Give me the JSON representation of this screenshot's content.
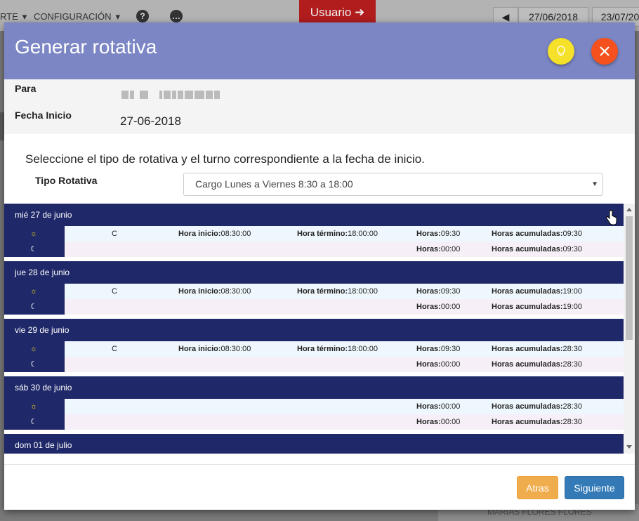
{
  "background": {
    "menu_report": "RTE",
    "menu_config": "CONFIGURACIÓN",
    "user_button": "Usuario",
    "date_from": "27/06/2018",
    "date_to": "23/07/20",
    "footer_text": "MARIAS FLORES FLORES"
  },
  "modal": {
    "title": "Generar rotativa",
    "para_label": "Para",
    "fecha_inicio_label": "Fecha Inicio",
    "fecha_inicio_value": "27-06-2018",
    "instruction": "Seleccione el tipo de rotativa y el turno correspondiente a la fecha de inicio.",
    "tipo_label": "Tipo Rotativa",
    "tipo_selected": "Cargo Lunes a Viernes 8:30 a 18:00",
    "back_button": "Atras",
    "next_button": "Siguiente"
  },
  "labels": {
    "hora_inicio": "Hora inicio:",
    "hora_termino": "Hora término:",
    "horas": "Horas:",
    "horas_acumuladas": "Horas acumuladas:"
  },
  "days": [
    {
      "date": "mié 27 de junio",
      "day_shift": {
        "code": "C",
        "inicio": "08:30:00",
        "termino": "18:00:00",
        "horas": "09:30",
        "acumuladas": "09:30"
      },
      "night_shift": {
        "horas": "00:00",
        "acumuladas": "09:30"
      }
    },
    {
      "date": "jue 28 de junio",
      "day_shift": {
        "code": "C",
        "inicio": "08:30:00",
        "termino": "18:00:00",
        "horas": "09:30",
        "acumuladas": "19:00"
      },
      "night_shift": {
        "horas": "00:00",
        "acumuladas": "19:00"
      }
    },
    {
      "date": "vie 29 de junio",
      "day_shift": {
        "code": "C",
        "inicio": "08:30:00",
        "termino": "18:00:00",
        "horas": "09:30",
        "acumuladas": "28:30"
      },
      "night_shift": {
        "horas": "00:00",
        "acumuladas": "28:30"
      }
    },
    {
      "date": "sáb 30 de junio",
      "day_shift": {
        "code": "",
        "inicio": "",
        "termino": "",
        "horas": "00:00",
        "acumuladas": "28:30"
      },
      "night_shift": {
        "horas": "00:00",
        "acumuladas": "28:30"
      }
    },
    {
      "date": "dom 01 de julio"
    }
  ],
  "colors": {
    "header_bg": "#7c86c4",
    "day_header_bg": "#1f2868",
    "hint_button": "#f5e12a",
    "close_button": "#f4511e",
    "back_button": "#f0ad4e",
    "next_button": "#337ab7"
  },
  "icons": {
    "hint": "lightbulb-icon",
    "close": "close-icon",
    "day_shift": "sun-icon",
    "night_shift": "moon-icon"
  }
}
